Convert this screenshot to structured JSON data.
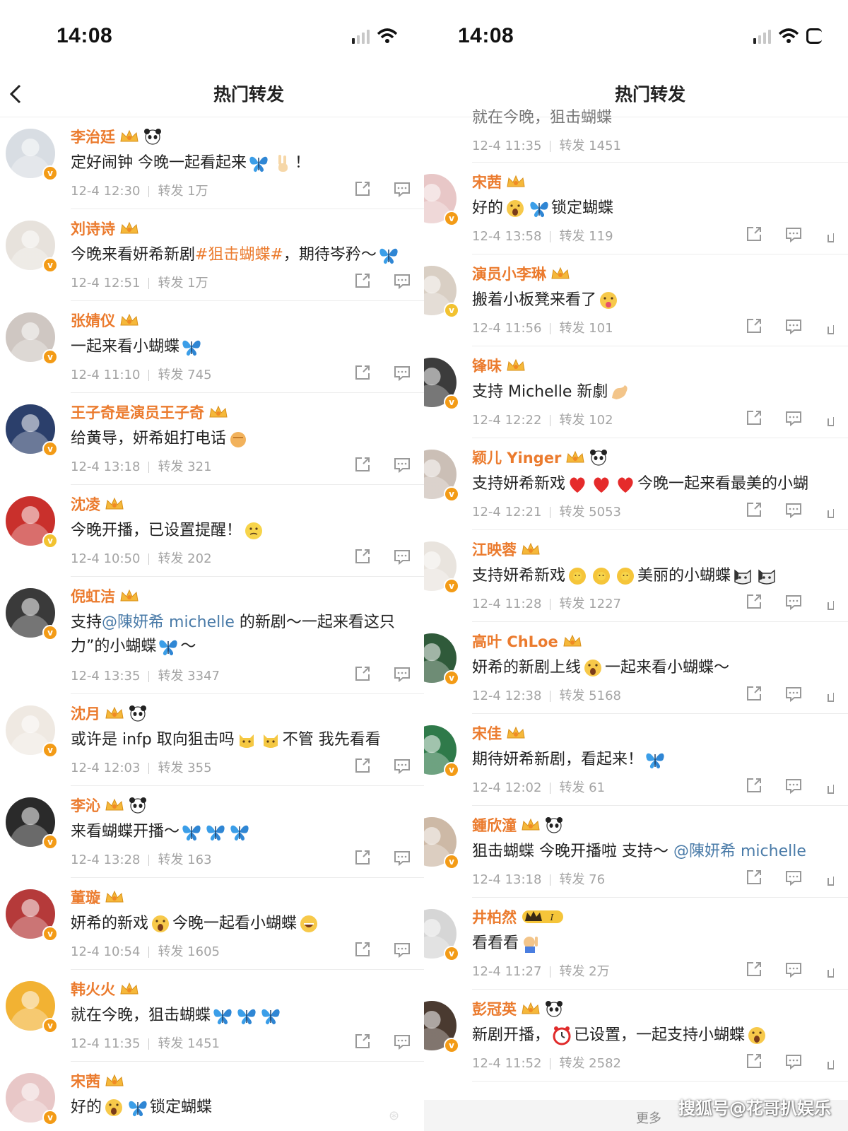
{
  "left": {
    "time": "14:08",
    "title": "热门转发",
    "items": [
      {
        "name": "李治廷",
        "badges": [
          "crown",
          "panda"
        ],
        "text": "定好闹钟 今晚一起看起来",
        "emojis": [
          "butterfly",
          "victory"
        ],
        "suffix": "！",
        "time": "12-4 12:30",
        "repost": "转发 1万",
        "avatar_color": "#d8dde3"
      },
      {
        "name": "刘诗诗",
        "badges": [
          "crown"
        ],
        "text_before": "今晚来看妍希新剧",
        "tag": "#狙击蝴蝶#",
        "text_after": "，期待岑矜～",
        "emojis": [
          "butterfly"
        ],
        "time": "12-4 12:51",
        "repost": "转发 1万",
        "avatar_color": "#e7e2dc"
      },
      {
        "name": "张婧仪",
        "badges": [
          "crown"
        ],
        "text": "一起来看小蝴蝶",
        "emojis": [
          "butterfly"
        ],
        "time": "12-4 11:10",
        "repost": "转发 745",
        "avatar_color": "#cfc7c2"
      },
      {
        "name": "王子奇是演员王子奇",
        "badges": [
          "crown"
        ],
        "text": "给黄导，妍希姐打电话",
        "emojis": [
          "fist"
        ],
        "time": "12-4 13:18",
        "repost": "转发 321",
        "avatar_color": "#2b3f6b"
      },
      {
        "name": "沈凌",
        "badges": [
          "crown"
        ],
        "text": "今晚开播，已设置提醒！",
        "emojis": [
          "thinking"
        ],
        "time": "12-4 10:50",
        "repost": "转发 202",
        "avatar_color": "#c9302c",
        "badge_yellow": true
      },
      {
        "name": "倪虹洁",
        "badges": [
          "crown"
        ],
        "text_before": "支持",
        "mention": "@陳妍希 michelle",
        "text_after": " 的新剧～一起来看这只",
        "line2": "力”的小蝴蝶",
        "line2_suffix": "～",
        "emojis": [
          "butterfly"
        ],
        "time": "12-4 13:35",
        "repost": "转发 3347",
        "avatar_color": "#3a3a3a",
        "tall": true
      },
      {
        "name": "沈月",
        "badges": [
          "crown",
          "panda"
        ],
        "text": "或许是 infp 取向狙击吗",
        "text_after": "不管 我先看看",
        "emojis": [
          "cat",
          "cat"
        ],
        "time": "12-4 12:03",
        "repost": "转发 355",
        "avatar_color": "#efe9e2"
      },
      {
        "name": "李沁",
        "badges": [
          "crown",
          "panda"
        ],
        "text": "来看蝴蝶开播～",
        "emojis": [
          "butterfly",
          "butterfly",
          "butterfly"
        ],
        "time": "12-4 13:28",
        "repost": "转发 163",
        "avatar_color": "#2a2a2a"
      },
      {
        "name": "董璇",
        "badges": [
          "crown"
        ],
        "text": "妍希的新戏",
        "text_after": "今晚一起看小蝴蝶",
        "emojis": [
          "scream",
          "grin"
        ],
        "time": "12-4 10:54",
        "repost": "转发 1605",
        "avatar_color": "#b53a3a"
      },
      {
        "name": "韩火火",
        "badges": [
          "crown"
        ],
        "text": "就在今晚，狙击蝴蝶",
        "emojis": [
          "butterfly",
          "butterfly",
          "butterfly"
        ],
        "time": "12-4 11:35",
        "repost": "转发 1451",
        "avatar_color": "#f2b233"
      },
      {
        "name": "宋茜",
        "badges": [
          "crown"
        ],
        "text": "好的",
        "text_after": "锁定蝴蝶",
        "emojis": [
          "scream",
          "butterfly"
        ],
        "time": "",
        "repost": "",
        "avatar_color": "#e8c7c7"
      }
    ]
  },
  "right": {
    "time": "14:08",
    "title": "热门转发",
    "partial_top": {
      "text": "就在今晚，狙击蝴蝶",
      "time": "12-4 11:35",
      "repost": "转发 1451"
    },
    "items": [
      {
        "name": "宋茜",
        "badges": [
          "crown"
        ],
        "text": "好的",
        "text_after": "锁定蝴蝶",
        "emojis": [
          "scream",
          "butterfly"
        ],
        "time": "12-4 13:58",
        "repost": "转发 119",
        "avatar_color": "#e8c7c7"
      },
      {
        "name": "演员小李琳",
        "badges": [
          "crown"
        ],
        "text": "搬着小板凳来看了",
        "emojis": [
          "tongue"
        ],
        "time": "12-4 11:56",
        "repost": "转发 101",
        "avatar_color": "#d9cfc4",
        "badge_yellow": true
      },
      {
        "name": "锋味",
        "badges": [
          "crown"
        ],
        "text": "支持 Michelle 新劇",
        "emojis": [
          "muscle"
        ],
        "time": "12-4 12:22",
        "repost": "转发 102",
        "avatar_color": "#3c3c3c"
      },
      {
        "name": "颖儿 Yinger",
        "badges": [
          "crown",
          "panda"
        ],
        "text": "支持妍希新戏",
        "text_after": "今晚一起来看最美的小蝴",
        "emojis": [
          "heart",
          "heart",
          "heart"
        ],
        "time": "12-4 12:21",
        "repost": "转发 5053",
        "avatar_color": "#cbbfb6"
      },
      {
        "name": "江映蓉",
        "badges": [
          "crown"
        ],
        "text": "支持妍希新戏",
        "text_after": "美丽的小蝴蝶",
        "emojis": [
          "sunflower",
          "sunflower",
          "sunflower",
          "catface",
          "catface"
        ],
        "time": "12-4 11:28",
        "repost": "转发 1227",
        "avatar_color": "#e9e4de"
      },
      {
        "name": "高叶 ChLoe",
        "badges": [
          "crown"
        ],
        "text": "妍希的新剧上线",
        "text_after": "一起来看小蝴蝶～",
        "emojis": [
          "scream"
        ],
        "time": "12-4 12:38",
        "repost": "转发 5168",
        "avatar_color": "#2f5a3a"
      },
      {
        "name": "宋佳",
        "badges": [
          "crown"
        ],
        "text": "期待妍希新剧，看起来！",
        "emojis": [
          "butterfly"
        ],
        "time": "12-4 12:02",
        "repost": "转发 61",
        "avatar_color": "#2f7a4a"
      },
      {
        "name": "鍾欣潼",
        "badges": [
          "crown",
          "panda"
        ],
        "text": "狙击蝴蝶 今晚开播啦 支持～",
        "mention": "@陳妍希 michelle",
        "emojis": [],
        "time": "12-4 13:18",
        "repost": "转发 76",
        "avatar_color": "#cdb9a6"
      },
      {
        "name": "井柏然",
        "badges": [
          "level"
        ],
        "text": "看看看",
        "emojis": [
          "raise"
        ],
        "time": "12-4 11:27",
        "repost": "转发 2万",
        "avatar_color": "#d6d6d6"
      },
      {
        "name": "彭冠英",
        "badges": [
          "crown",
          "panda"
        ],
        "text": "新剧开播，",
        "text_after": "已设置，一起支持小蝴蝶",
        "emojis": [
          "clock",
          "scream"
        ],
        "time": "12-4 11:52",
        "repost": "转发 2582",
        "avatar_color": "#4a3a30"
      }
    ],
    "footer_more": "更多"
  },
  "watermark": "搜狐号@花哥扒娱乐",
  "colors": {
    "name": "#eb7b2e",
    "meta": "#a4a4a4",
    "mention": "#4a7ba8",
    "badge": "#f39b16"
  }
}
